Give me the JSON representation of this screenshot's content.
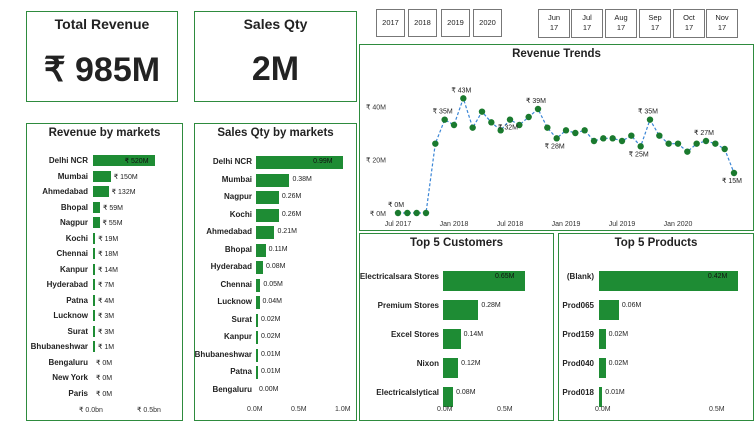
{
  "kpis": {
    "revenue_title": "Total Revenue",
    "revenue_value": "₹ 985M",
    "qty_title": "Sales Qty",
    "qty_value": "2M"
  },
  "year_slicer": [
    "2017",
    "2018",
    "2019",
    "2020"
  ],
  "month_slicer": [
    {
      "m": "Jun",
      "y": "17"
    },
    {
      "m": "Jul",
      "y": "17"
    },
    {
      "m": "Aug",
      "y": "17"
    },
    {
      "m": "Sep",
      "y": "17"
    },
    {
      "m": "Oct",
      "y": "17"
    },
    {
      "m": "Nov",
      "y": "17"
    }
  ],
  "colors": {
    "bar": "#1e8c34",
    "line": "#3b86d6",
    "point": "#1a7a2e",
    "border": "#2e8b3e"
  },
  "chart_data": [
    {
      "type": "bar",
      "title": "Revenue by markets",
      "categories": [
        "Delhi NCR",
        "Mumbai",
        "Ahmedabad",
        "Bhopal",
        "Nagpur",
        "Kochi",
        "Chennai",
        "Kanpur",
        "Hyderabad",
        "Patna",
        "Lucknow",
        "Surat",
        "Bhubaneshwar",
        "Bengaluru",
        "New York",
        "Paris"
      ],
      "values": [
        520,
        150,
        132,
        59,
        55,
        19,
        18,
        14,
        7,
        4,
        3,
        3,
        1,
        0,
        0,
        0
      ],
      "labels": [
        "₹ 520M",
        "₹ 150M",
        "₹ 132M",
        "₹ 59M",
        "₹ 55M",
        "₹ 19M",
        "₹ 18M",
        "₹ 14M",
        "₹ 7M",
        "₹ 4M",
        "₹ 3M",
        "₹ 3M",
        "₹ 1M",
        "₹ 0M",
        "₹ 0M",
        "₹ 0M"
      ],
      "xlim": [
        0,
        540
      ],
      "xticks": [
        "₹ 0.0bn",
        "₹ 0.5bn"
      ]
    },
    {
      "type": "bar",
      "title": "Sales Qty by markets",
      "categories": [
        "Delhi NCR",
        "Mumbai",
        "Nagpur",
        "Kochi",
        "Ahmedabad",
        "Bhopal",
        "Hyderabad",
        "Chennai",
        "Lucknow",
        "Surat",
        "Kanpur",
        "Bhubaneshwar",
        "Patna",
        "Bengaluru"
      ],
      "values": [
        0.99,
        0.38,
        0.26,
        0.26,
        0.21,
        0.11,
        0.08,
        0.05,
        0.04,
        0.02,
        0.02,
        0.01,
        0.01,
        0.0
      ],
      "labels": [
        "0.99M",
        "0.38M",
        "0.26M",
        "0.26M",
        "0.21M",
        "0.11M",
        "0.08M",
        "0.05M",
        "0.04M",
        "0.02M",
        "0.02M",
        "0.01M",
        "0.01M",
        "0.00M"
      ],
      "xlim": [
        0,
        1.0
      ],
      "xticks": [
        "0.0M",
        "0.5M",
        "1.0M"
      ]
    },
    {
      "type": "line",
      "title": "Revenue Trends",
      "values": [
        0,
        0,
        0,
        0,
        26,
        35,
        33,
        43,
        32,
        38,
        34,
        31,
        35,
        33,
        36,
        39,
        32,
        28,
        31,
        30,
        31,
        27,
        28,
        28,
        27,
        29,
        25,
        35,
        29,
        26,
        26,
        23,
        26,
        27,
        26,
        24,
        15
      ],
      "labels": {
        "0": "₹ 0M",
        "5": "₹ 35M",
        "7": "₹ 43M",
        "12": "₹ 32M",
        "15": "₹ 39M",
        "17": "₹ 28M",
        "26": "₹ 25M",
        "27": "₹ 35M",
        "33": "₹ 27M",
        "36": "₹ 15M"
      },
      "ylim": [
        0,
        45
      ],
      "yticks": [
        {
          "v": 0,
          "t": "₹ 0M"
        },
        {
          "v": 20,
          "t": "₹ 20M"
        },
        {
          "v": 40,
          "t": "₹ 40M"
        }
      ],
      "xticks": [
        "Jul 2017",
        "Jan 2018",
        "Jul 2018",
        "Jan 2019",
        "Jul 2019",
        "Jan 2020"
      ]
    },
    {
      "type": "bar",
      "title": "Top 5 Customers",
      "categories": [
        "Electricalsara Stores",
        "Premium Stores",
        "Excel Stores",
        "Nixon",
        "Electricalslytical"
      ],
      "values": [
        0.65,
        0.28,
        0.14,
        0.12,
        0.08
      ],
      "labels": [
        "0.65M",
        "0.28M",
        "0.14M",
        "0.12M",
        "0.08M"
      ],
      "xlim": [
        0,
        0.65
      ],
      "xticks": [
        "0.0M",
        "0.5M"
      ]
    },
    {
      "type": "bar",
      "title": "Top 5 Products",
      "categories": [
        "(Blank)",
        "Prod065",
        "Prod159",
        "Prod040",
        "Prod018"
      ],
      "values": [
        0.42,
        0.06,
        0.02,
        0.02,
        0.01
      ],
      "labels": [
        "0.42M",
        "0.06M",
        "0.02M",
        "0.02M",
        "0.01M"
      ],
      "xlim": [
        0,
        0.65
      ],
      "xticks": [
        "0.0M",
        "0.5M"
      ]
    }
  ]
}
